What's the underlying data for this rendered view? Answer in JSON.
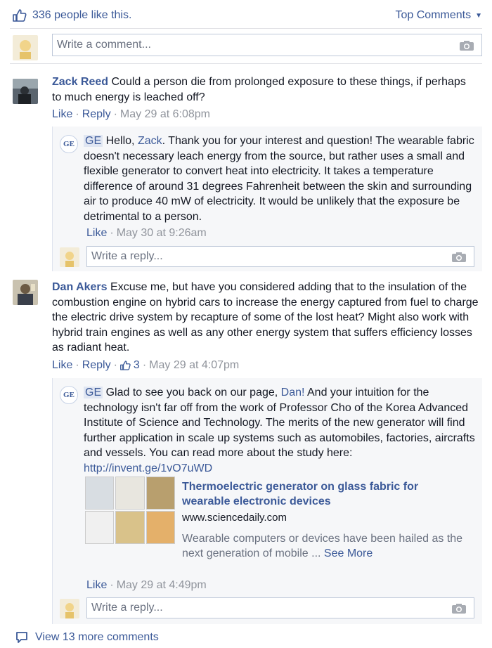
{
  "header": {
    "likes_text": "336 people like this.",
    "sort_label": "Top Comments"
  },
  "composer": {
    "placeholder": "Write a comment..."
  },
  "comments": [
    {
      "author": "Zack Reed",
      "text": "Could a person die from prolonged exposure to these things, if perhaps to much energy is leached off?",
      "like": "Like",
      "reply": "Reply",
      "time": "May 29 at 6:08pm",
      "reply_item": {
        "author_tag": "GE",
        "text_pre": "Hello,",
        "mention": "Zack",
        "text_post": ". Thank you for your interest and question! The wearable fabric doesn't necessary leach energy from the source, but rather uses a small and flexible generator to convert heat into electricity. It takes a temperature difference of around 31 degrees Fahrenheit between the skin and surrounding air to produce 40 mW of electricity. It would be unlikely that the exposure be detrimental to a person.",
        "like": "Like",
        "time": "May 30 at 9:26am"
      },
      "reply_placeholder": "Write a reply..."
    },
    {
      "author": "Dan Akers",
      "text": "Excuse me, but have you considered adding that to the insulation of the combustion engine on hybrid cars to increase the energy captured from fuel to charge the electric drive system by recapture of some of the lost heat? Might also work with hybrid train engines as well as any other energy system that suffers efficiency losses as radiant heat.",
      "like": "Like",
      "reply": "Reply",
      "like_count": "3",
      "time": "May 29 at 4:07pm",
      "reply_item": {
        "author_tag": "GE",
        "text_pre": "Glad to see you back on our page,",
        "mention": "Dan!",
        "text_post": " And your intuition for the technology isn't far off from the work of Professor Cho of the Korea Advanced Institute of Science and Technology. The merits of the new generator will find further application in scale up systems such as automobiles, factories, aircrafts and vessels. You can read more about the study here:",
        "link": "http://invent.ge/1vO7uWD",
        "preview_title": "Thermoelectric generator on glass fabric for wearable electronic devices",
        "preview_domain": "www.sciencedaily.com",
        "preview_desc": "Wearable computers or devices have been hailed as the next generation of mobile ...",
        "see_more": "See More",
        "like": "Like",
        "time": "May 29 at 4:49pm"
      },
      "reply_placeholder": "Write a reply..."
    }
  ],
  "footer": {
    "view_more": "View 13 more comments"
  },
  "colors": {
    "link": "#3b5998",
    "meta": "#90949c",
    "panel": "#f6f7f9"
  }
}
